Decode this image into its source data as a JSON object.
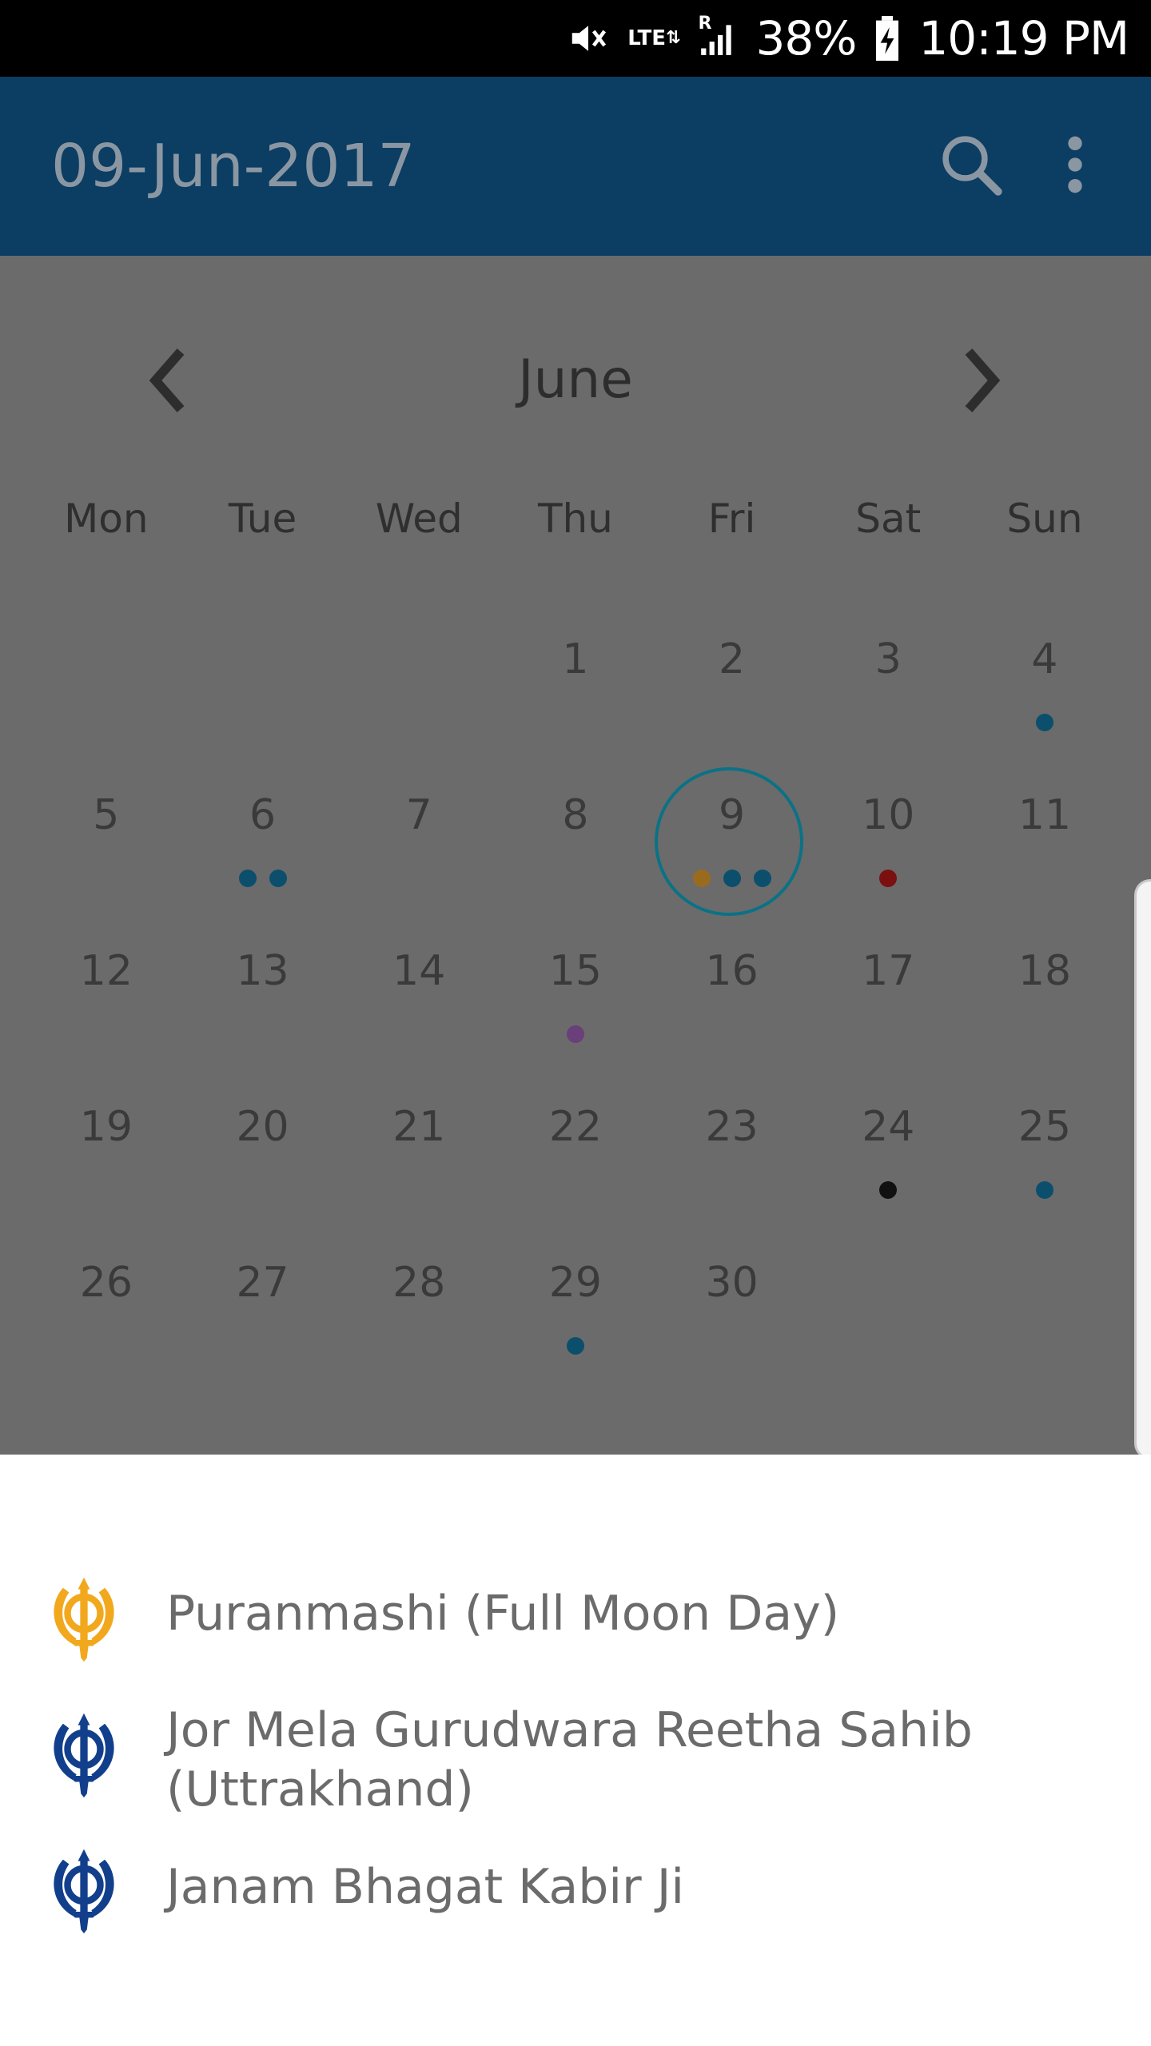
{
  "status_bar": {
    "battery": "38%",
    "time": "10:19 PM",
    "network_label": "LTE",
    "roaming_label": "R",
    "icons": [
      "mute-icon",
      "lte-icon",
      "signal-icon",
      "battery-charging-icon"
    ]
  },
  "app_bar": {
    "title": "09-Jun-2017",
    "icons": [
      "search-icon",
      "overflow-menu-icon"
    ],
    "color": "#0c3d63"
  },
  "calendar": {
    "month": "June",
    "weekdays": [
      "Mon",
      "Tue",
      "Wed",
      "Thu",
      "Fri",
      "Sat",
      "Sun"
    ],
    "selected_day": "9",
    "weeks": [
      [
        {
          "day": "",
          "dots": []
        },
        {
          "day": "",
          "dots": []
        },
        {
          "day": "",
          "dots": []
        },
        {
          "day": "1",
          "dots": []
        },
        {
          "day": "2",
          "dots": []
        },
        {
          "day": "3",
          "dots": []
        },
        {
          "day": "4",
          "dots": [
            "#0b4f6c"
          ]
        }
      ],
      [
        {
          "day": "5",
          "dots": []
        },
        {
          "day": "6",
          "dots": [
            "#0b4f6c",
            "#0b4f6c"
          ]
        },
        {
          "day": "7",
          "dots": []
        },
        {
          "day": "8",
          "dots": []
        },
        {
          "day": "9",
          "dots": [
            "#9a6b1f",
            "#0b4f6c",
            "#0b4f6c"
          ],
          "selected": true
        },
        {
          "day": "10",
          "dots": [
            "#7a1010"
          ]
        },
        {
          "day": "11",
          "dots": []
        }
      ],
      [
        {
          "day": "12",
          "dots": []
        },
        {
          "day": "13",
          "dots": []
        },
        {
          "day": "14",
          "dots": []
        },
        {
          "day": "15",
          "dots": [
            "#6a3f7a"
          ]
        },
        {
          "day": "16",
          "dots": []
        },
        {
          "day": "17",
          "dots": []
        },
        {
          "day": "18",
          "dots": []
        }
      ],
      [
        {
          "day": "19",
          "dots": []
        },
        {
          "day": "20",
          "dots": []
        },
        {
          "day": "21",
          "dots": []
        },
        {
          "day": "22",
          "dots": []
        },
        {
          "day": "23",
          "dots": []
        },
        {
          "day": "24",
          "dots": [
            "#111111"
          ]
        },
        {
          "day": "25",
          "dots": [
            "#0b4f6c"
          ]
        }
      ],
      [
        {
          "day": "26",
          "dots": []
        },
        {
          "day": "27",
          "dots": []
        },
        {
          "day": "28",
          "dots": []
        },
        {
          "day": "29",
          "dots": [
            "#0b4f6c"
          ]
        },
        {
          "day": "30",
          "dots": []
        },
        {
          "day": "",
          "dots": []
        },
        {
          "day": "",
          "dots": []
        }
      ]
    ]
  },
  "events": [
    {
      "label": "Puranmashi  (Full Moon Day)",
      "icon": "khanda-icon",
      "color": "#f2a81d"
    },
    {
      "label": "Jor Mela Gurudwara Reetha Sahib (Uttrakhand)",
      "icon": "khanda-icon",
      "color": "#123f8c"
    },
    {
      "label": "Janam Bhagat Kabir Ji",
      "icon": "khanda-icon",
      "color": "#123f8c"
    }
  ]
}
